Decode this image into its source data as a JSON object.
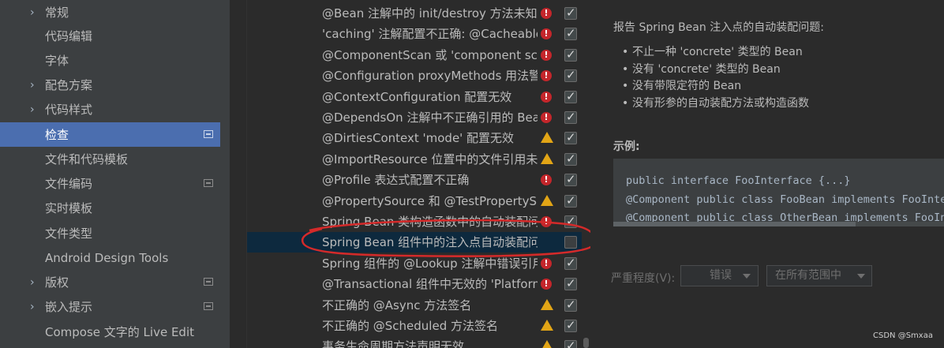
{
  "nav": {
    "items": [
      {
        "label": "常规",
        "arrow": "›",
        "badge": false,
        "selected": false
      },
      {
        "label": "代码编辑",
        "arrow": "",
        "badge": false,
        "selected": false
      },
      {
        "label": "字体",
        "arrow": "",
        "badge": false,
        "selected": false
      },
      {
        "label": "配色方案",
        "arrow": "›",
        "badge": false,
        "selected": false
      },
      {
        "label": "代码样式",
        "arrow": "›",
        "badge": false,
        "selected": false
      },
      {
        "label": "检查",
        "arrow": "",
        "badge": true,
        "selected": true
      },
      {
        "label": "文件和代码模板",
        "arrow": "",
        "badge": false,
        "selected": false
      },
      {
        "label": "文件编码",
        "arrow": "",
        "badge": true,
        "selected": false
      },
      {
        "label": "实时模板",
        "arrow": "",
        "badge": false,
        "selected": false
      },
      {
        "label": "文件类型",
        "arrow": "",
        "badge": false,
        "selected": false
      },
      {
        "label": "Android Design Tools",
        "arrow": "",
        "badge": false,
        "selected": false
      },
      {
        "label": "版权",
        "arrow": "›",
        "badge": true,
        "selected": false
      },
      {
        "label": "嵌入提示",
        "arrow": "›",
        "badge": true,
        "selected": false
      },
      {
        "label": "Compose 文字的 Live Edit",
        "arrow": "",
        "badge": false,
        "selected": false
      }
    ]
  },
  "inspections": {
    "rows": [
      {
        "label": "@Bean 注解中的 init/destroy 方法未知",
        "severity": "error",
        "checked": true,
        "selected": false
      },
      {
        "label": "'caching' 注解配置不正确: @Cacheable.",
        "severity": "error",
        "checked": true,
        "selected": false
      },
      {
        "label": "@ComponentScan 或 'component sca",
        "severity": "error",
        "checked": true,
        "selected": false
      },
      {
        "label": "@Configuration proxyMethods 用法警",
        "severity": "error",
        "checked": true,
        "selected": false
      },
      {
        "label": "@ContextConfiguration 配置无效",
        "severity": "error",
        "checked": true,
        "selected": false
      },
      {
        "label": "@DependsOn 注解中不正确引用的 Bean",
        "severity": "error",
        "checked": true,
        "selected": false
      },
      {
        "label": "@DirtiesContext 'mode' 配置无效",
        "severity": "warning",
        "checked": true,
        "selected": false
      },
      {
        "label": "@ImportResource 位置中的文件引用未",
        "severity": "warning",
        "checked": true,
        "selected": false
      },
      {
        "label": "@Profile 表达式配置不正确",
        "severity": "error",
        "checked": true,
        "selected": false
      },
      {
        "label": "@PropertySource 和 @TestPropertyS",
        "severity": "warning",
        "checked": true,
        "selected": false
      },
      {
        "label": "Spring Bean 类构造函数中的自动装配问",
        "severity": "error",
        "checked": true,
        "selected": false
      },
      {
        "label": "Spring Bean 组件中的注入点自动装配问",
        "severity": "",
        "checked": false,
        "selected": true
      },
      {
        "label": "Spring 组件的 @Lookup 注解中错误引用",
        "severity": "error",
        "checked": true,
        "selected": false
      },
      {
        "label": "@Transactional 组件中无效的 'Platform",
        "severity": "error",
        "checked": true,
        "selected": false
      },
      {
        "label": "不正确的 @Async 方法签名",
        "severity": "warning",
        "checked": true,
        "selected": false
      },
      {
        "label": "不正确的 @Scheduled 方法签名",
        "severity": "warning",
        "checked": true,
        "selected": false
      },
      {
        "label": "事务生命周期方法声明无效",
        "severity": "warning",
        "checked": true,
        "selected": false
      }
    ]
  },
  "detail": {
    "title": "报告 Spring Bean 注入点的自动装配问题:",
    "bullets": [
      "不止一种 'concrete' 类型的 Bean",
      "没有 'concrete' 类型的 Bean",
      "没有带限定符的 Bean",
      "没有形参的自动装配方法或构造函数"
    ],
    "example_label": "示例:",
    "code_lines": [
      "public interface FooInterface {...}",
      "  @Component public class FooBean implements FooInterface {...}",
      "  @Component public class OtherBean implements FooInterface {...}"
    ],
    "severity_label": "严重程度(V):",
    "severity_value": "错误",
    "scope_value": "在所有范围中"
  },
  "watermark": "CSDN @Smxaa",
  "colors": {
    "selection": "#4b6eaf",
    "row_selection": "#0d293e",
    "error": "#c4262b",
    "warning": "#e2a516",
    "annotation": "#d42a2a"
  }
}
